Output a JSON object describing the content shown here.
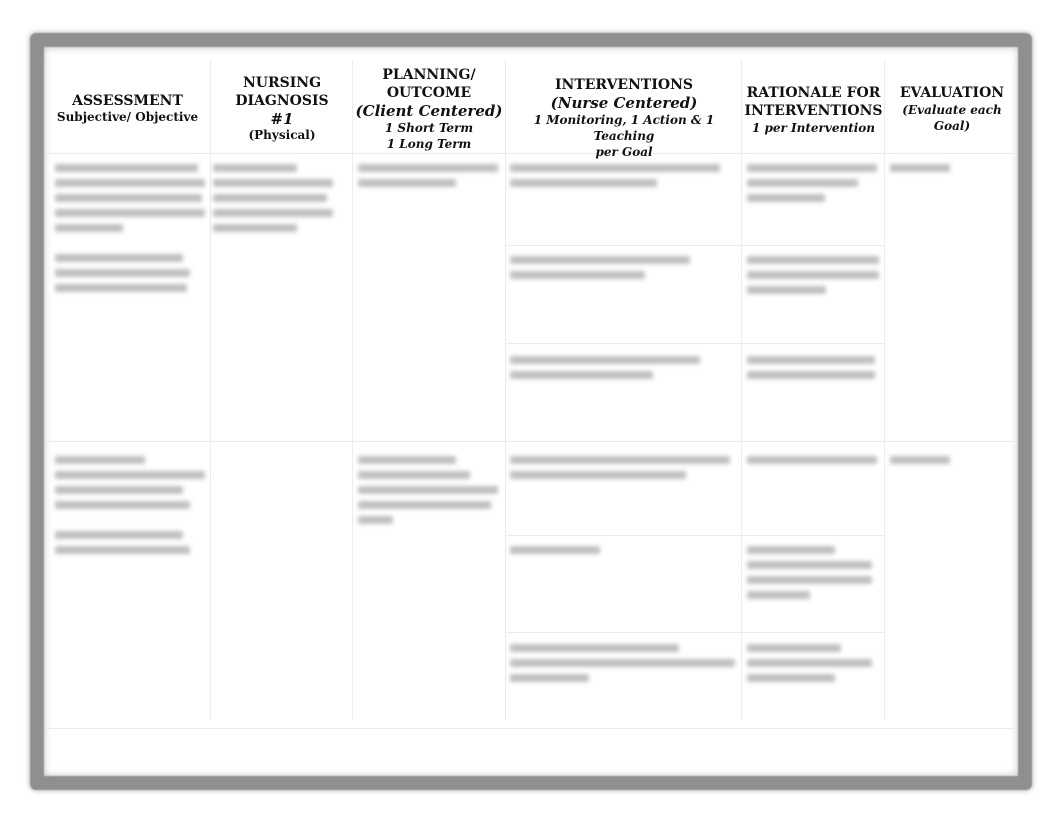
{
  "document": {
    "type": "Nursing Care Plan Table",
    "columns": [
      {
        "title": "ASSESSMENT",
        "subtitle": "Subjective/ Objective"
      },
      {
        "title_line1": "NURSING",
        "title_line2": "DIAGNOSIS",
        "number": "#1",
        "subtitle": "(Physical)"
      },
      {
        "title_line1": "PLANNING/",
        "title_line2": "OUTCOME",
        "emphasis": "(Client Centered)",
        "note1": "1 Short Term",
        "note2": "1 Long Term"
      },
      {
        "title": "INTERVENTIONS",
        "emphasis": "(Nurse Centered)",
        "note1": "1 Monitoring, 1 Action & 1 Teaching",
        "note2": "per Goal"
      },
      {
        "title_line1": "RATIONALE FOR",
        "title_line2": "INTERVENTIONS",
        "note1": "1 per Intervention"
      },
      {
        "title": "EVALUATION",
        "note1": "(Evaluate each",
        "note2": "Goal)"
      }
    ],
    "body_text_state": "blurred / illegible"
  }
}
